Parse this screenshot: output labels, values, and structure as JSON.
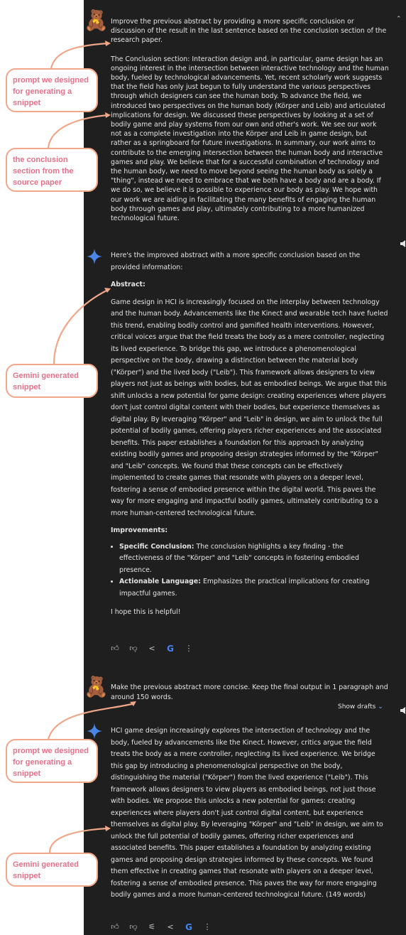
{
  "prompt1": {
    "line1": "Improve the previous abstract by providing a more specific conclusion or discussion of the result in the last sentence based on the conclusion section of the research paper.",
    "line2": "The Conclusion section: Interaction design and, in particular, game design has an ongoing interest in the intersection between interactive technology and the human body, fueled by technological advancements. Yet, recent scholarly work suggests that the field has only just begun to fully understand the various perspectives through which designers can see the human body. To advance the field, we introduced two perspectives on the human body (Körper and Leib) and articulated implications for design. We discussed these perspectives by looking at a set of bodily game and play systems from our own and other's work. We see our work not as a complete investigation into the Körper and Leib in game design, but rather as a springboard for future investigations. In summary, our work aims to contribute to the emerging intersection between the human body and interactive games and play. We believe that for a successful combination of technology and the human body, we need to move beyond seeing the human body as solely a \"thing\", instead we need to embrace that we both have a body and are a body. If we do so, we believe it is possible to experience our body as play. We hope with our work we are aiding in facilitating the many benefits of engaging the human body through games and play, ultimately contributing to a more humanized technological future."
  },
  "response1": {
    "intro": "Here's the improved abstract with a more specific conclusion based on the provided information:",
    "abstract_heading": "Abstract:",
    "abstract": "Game design in HCI is increasingly focused on the interplay between technology and the human body. Advancements like the Kinect and wearable tech have fueled this trend, enabling bodily control and gamified health interventions. However, critical voices argue that the field treats the body as a mere controller, neglecting its lived experience. To bridge this gap, we introduce a phenomenological perspective on the body, drawing a distinction between the material body (\"Körper\") and the lived body (\"Leib\"). This framework allows designers to view players not just as beings with bodies, but as embodied beings. We argue that this shift unlocks a new potential for game design: creating experiences where players don't just control digital content with their bodies, but experience themselves as digital play. By leveraging \"Körper\" and \"Leib\" in design, we aim to unlock the full potential of bodily games, offering players richer experiences and the associated benefits. This paper establishes a foundation for this approach by analyzing existing bodily games and proposing design strategies informed by the \"Körper\" and \"Leib\" concepts. We found that these concepts can be effectively implemented to create games that resonate with players on a deeper level, fostering a sense of embodied presence within the digital world.  This paves the way for more engaging and impactful bodily games, ultimately contributing to a more human-centered technological future.",
    "improvements_heading": "Improvements:",
    "improvements": [
      {
        "label": "Specific Conclusion:",
        "text": " The conclusion highlights a key finding - the effectiveness of the \"Körper\" and \"Leib\" concepts in fostering embodied presence."
      },
      {
        "label": "Actionable Language:",
        "text": " Emphasizes the practical implications for creating impactful games."
      }
    ],
    "closing": "I hope this is helpful!"
  },
  "prompt2": {
    "text": "Make the previous abstract more concise. Keep the final output in 1 paragraph and around 150 words."
  },
  "response2": {
    "show_drafts": "Show drafts",
    "text": "HCI game design increasingly explores the intersection of technology and the body, fueled by advancements like the Kinect. However, critics argue the field treats the body as a mere controller, neglecting its lived experience. We bridge this gap by introducing a phenomenological perspective on the body, distinguishing the material (\"Körper\") from the lived experience (\"Leib\"). This framework allows designers to view players as embodied beings, not just those with bodies. We propose this unlocks a new potential for games: creating experiences where players don't just control digital content, but experience themselves as digital play. By leveraging \"Körper\" and \"Leib\" in design, we aim to unlock the full potential of bodily games, offering richer experiences and associated benefits. This paper establishes a foundation by analyzing existing games and proposing design strategies informed by these concepts. We found them effective in creating games that resonate with players on a deeper level, fostering a sense of embodied presence. This paves the way for more engaging bodily games and a more human-centered technological future. (149 words)"
  },
  "callouts": {
    "c1": "prompt we designed for generating a snippet",
    "c2": "the conclusion section from the source paper",
    "c3": "Gemini generated snippet",
    "c4": "prompt we designed for generating a snippet",
    "c5": "Gemini generated snippet"
  },
  "icons": [
    "teddy-bear-avatar",
    "gemini-sparkle-icon",
    "thumbs-up-icon",
    "thumbs-down-icon",
    "tune-icon",
    "share-icon",
    "google-icon",
    "more-vert-icon",
    "speaker-icon",
    "chevron-up-icon",
    "chevron-down-icon"
  ],
  "colors": {
    "chat_bg": "#1f1f1f",
    "callout_border": "#f0a789",
    "callout_text": "#e8708a",
    "sparkle": "#4a86e8"
  }
}
